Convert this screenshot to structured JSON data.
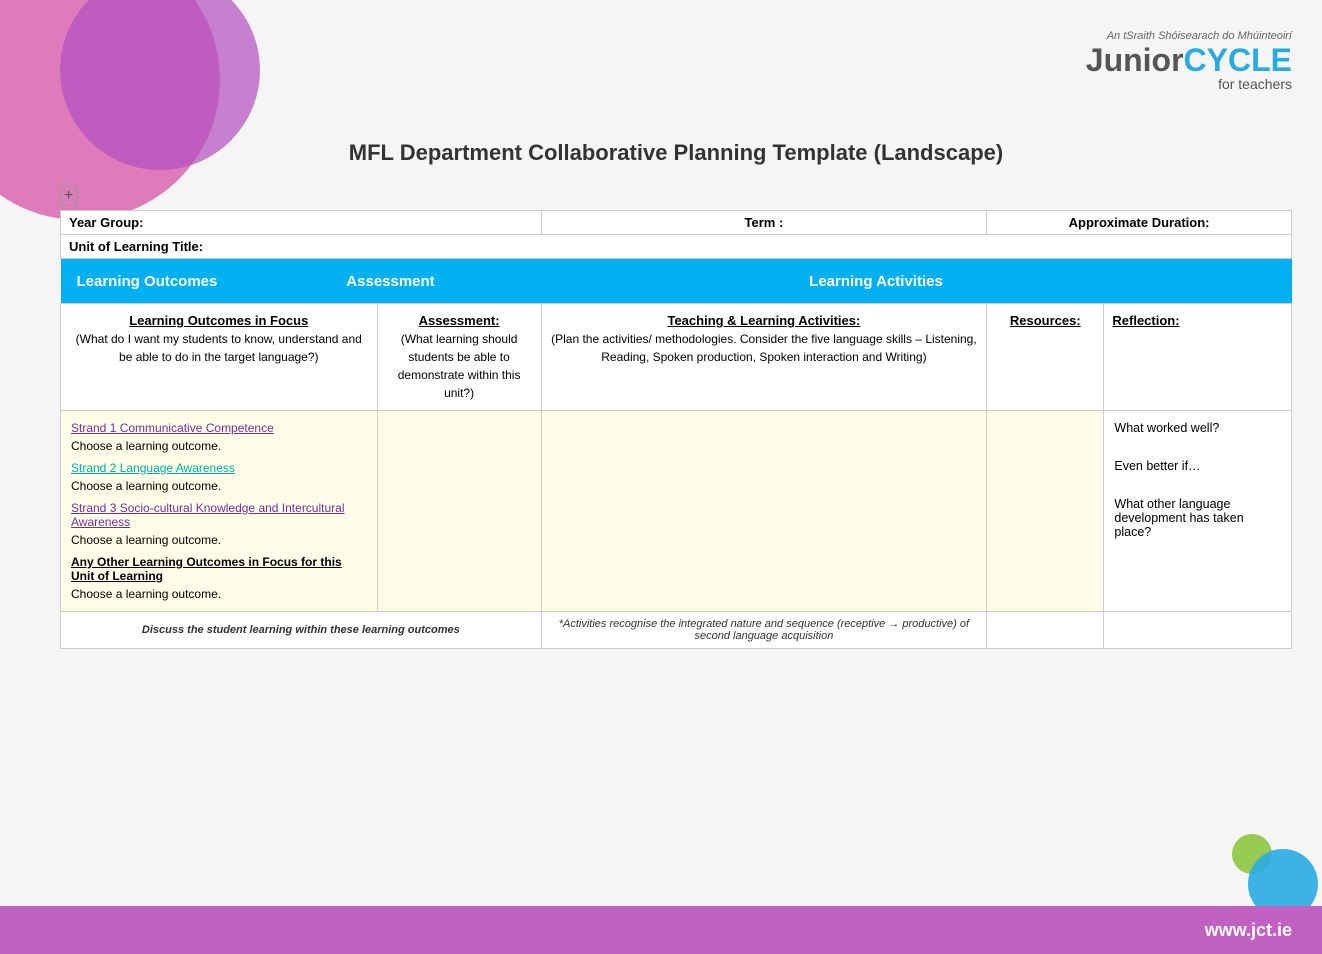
{
  "page": {
    "title": "MFL Department Collaborative Planning Template (Landscape)"
  },
  "logo": {
    "tagline": "An tSraith Shóisearach do Mhúinteoirí",
    "junior": "Junior",
    "cycle": "CYCLE",
    "for_teachers": "for teachers"
  },
  "footer_url": "www.jct.ie",
  "header": {
    "year_group_label": "Year Group:",
    "term_label": "Term :",
    "duration_label": "Approximate Duration:",
    "unit_label": "Unit of Learning Title:"
  },
  "arrow_header": {
    "learning_outcomes": "Learning Outcomes",
    "assessment": "Assessment",
    "learning_activities": "Learning Activities"
  },
  "columns": {
    "learning_outcomes": "Learning Outcomes in Focus",
    "learning_outcomes_sub": "(What do I want my students to know, understand and be able to do in the target language?)",
    "assessment": "Assessment:",
    "assessment_sub": "(What learning should students be able to demonstrate within this unit?)",
    "activities": "Teaching & Learning Activities:",
    "activities_sub": "(Plan the activities/ methodologies. Consider the five language skills – Listening, Reading, Spoken production, Spoken interaction and Writing)",
    "resources": "Resources:",
    "reflection": "Reflection:"
  },
  "strands": {
    "strand1": "Strand 1 Communicative Competence",
    "strand1_choose": "Choose a learning outcome.",
    "strand2": "Strand 2 Language Awareness",
    "strand2_choose": "Choose a learning outcome.",
    "strand3": "Strand 3 Socio-cultural Knowledge and Intercultural Awareness",
    "strand3_choose": "Choose a learning outcome.",
    "any_other": "Any Other Learning Outcomes in Focus for this Unit of Learning",
    "any_other_choose": "Choose a learning outcome."
  },
  "reflection_content": {
    "what_worked": "What worked well?",
    "even_better": "Even better if…",
    "language_dev": "What other language development has taken place?"
  },
  "footer": {
    "left": "Discuss the student learning within these learning outcomes",
    "right": "*Activities recognise the integrated nature and sequence (receptive → productive) of second language acquisition"
  }
}
